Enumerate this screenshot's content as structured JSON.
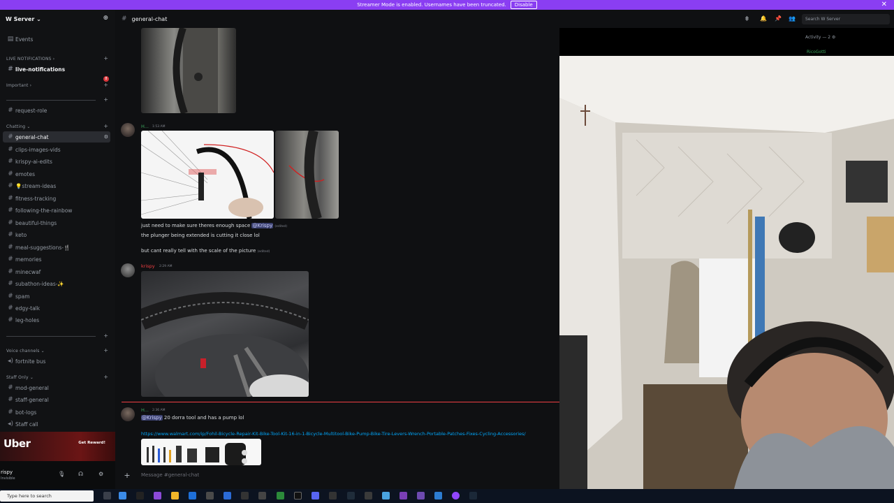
{
  "banner": {
    "text": "Streamer Mode is enabled. Usernames have been truncated.",
    "button": "Disable",
    "close": "✕"
  },
  "server": {
    "name": "W Server ⌄",
    "events": "Events"
  },
  "categories": {
    "live": "LIVE NOTIFICATIONS ›",
    "important": "Important ›",
    "chatting": "Chatting ⌄",
    "voice": "Voice channels ⌄",
    "staff": "Staff Only ⌄"
  },
  "channels": {
    "live_notifications": "live-notifications",
    "live_badge": "8",
    "request_role": "request-role",
    "general_chat": "general-chat",
    "clips": "clips-images-vids",
    "krispy_ai": "krispy-ai-edits",
    "emotes": "emotes",
    "stream_ideas": "💡stream-ideas",
    "fitness": "fitness-tracking",
    "rainbow": "following-the-rainbow",
    "beautiful": "beautiful-things",
    "keto": "keto",
    "meal": "meal-suggestions-🍴",
    "memories": "memories",
    "minecwaf": "minecwaf",
    "subathon": "subathon-ideas-✨",
    "spam": "spam",
    "edgy": "edgy-talk",
    "leg": "leg-holes",
    "fortnite": "fortnite bus",
    "mod": "mod-general",
    "staff_general": "staff-general",
    "bot_logs": "bot-logs",
    "staff_call": "Staff call"
  },
  "ad": {
    "brand": "Uber",
    "cta": "Get Reward!"
  },
  "user": {
    "name": "rispy",
    "status": "Invisible"
  },
  "chat": {
    "channel": "general-chat",
    "messages": [
      {
        "user": "H...",
        "time": "1:53 AM",
        "user_color": "#3ba55c"
      },
      {
        "text_prefix": "just need to make sure theres enough space ",
        "mention": "@Krispy",
        "edited": "(edited)"
      },
      {
        "text": "the plunger being extended is cutting it close lol"
      },
      {
        "text": "but cant really tell with the scale of the picture",
        "edited": "(edited)"
      },
      {
        "user": "krispy",
        "time": "2:29 AM",
        "user_color": "#f23f43"
      },
      {
        "user": "H...",
        "time": "2:36 AM",
        "user_color": "#3ba55c"
      },
      {
        "mention": "@Krispy",
        "text": " 20 dorra tool and has a pump lol"
      },
      {
        "link": "https://www.walmart.com/ip/Fohil-Bicycle-Repair-Kit-Bike-Tool-Kit-16-in-1-Bicycle-Multitool-Bike-Pump-Bike-Tire-Levers-Wrench-Portable-Patches-Fixes-Cycling-Accessories/"
      }
    ],
    "composer_placeholder": "Message #general-chat"
  },
  "header": {
    "search_placeholder": "Search W Server",
    "activity": "Activity — 2 ⚙",
    "activity_user": "RicoGotti"
  },
  "taskbar": {
    "search": "Type here to search"
  },
  "colors": {
    "banner": "#8a3ef2",
    "sidebar": "#111214",
    "chat": "#0f1012",
    "mention": "#3c4270",
    "link": "#00a8fc",
    "unread": "#f23f43"
  }
}
